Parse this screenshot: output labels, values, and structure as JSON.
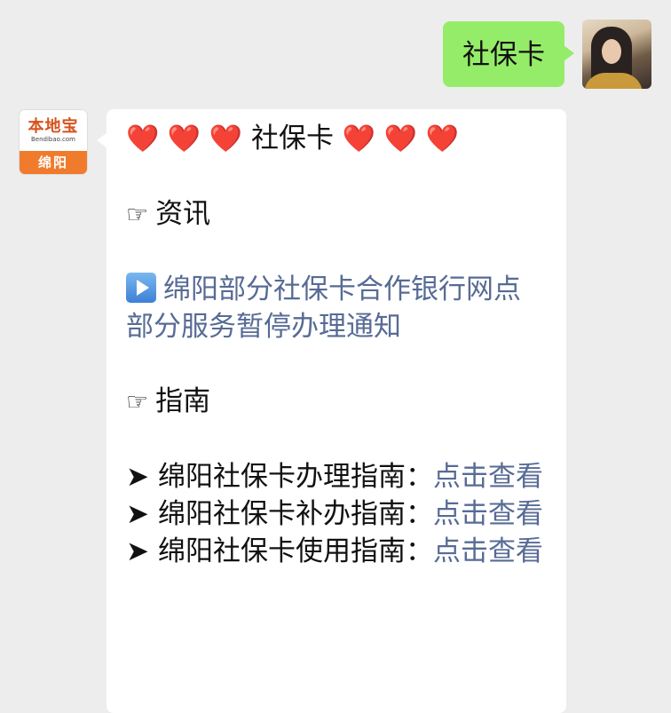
{
  "outgoing": {
    "text": "社保卡"
  },
  "bot": {
    "logo_brand": "本地宝",
    "logo_url": "Bendibao.com",
    "logo_city": "绵阳"
  },
  "message": {
    "title_hearts_left": "❤️ ❤️ ❤️",
    "title": "社保卡",
    "title_hearts_right": "❤️ ❤️ ❤️",
    "section_news": "资讯",
    "news_link": "绵阳部分社保卡合作银行网点部分服务暂停办理通知",
    "section_guide": "指南",
    "guides": [
      {
        "label": "绵阳社保卡办理指南：",
        "link": "点击查看"
      },
      {
        "label": "绵阳社保卡补办指南：",
        "link": "点击查看"
      },
      {
        "label": "绵阳社保卡使用指南：",
        "link": "点击查看"
      }
    ]
  },
  "icons": {
    "pointing_hand": "☞",
    "play_button": "play-icon",
    "arrow": "➤"
  },
  "colors": {
    "chat_bg": "#ededed",
    "outgoing_bubble": "#95ec69",
    "incoming_bubble": "#ffffff",
    "link": "#576b95",
    "heart": "#e02424"
  }
}
